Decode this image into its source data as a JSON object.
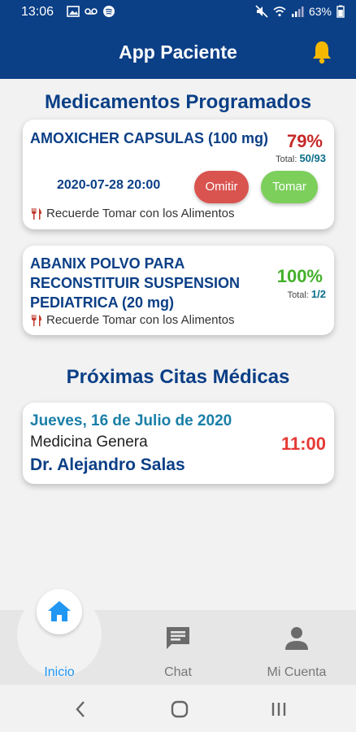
{
  "status_bar": {
    "time": "13:06",
    "battery": "63%",
    "left_icons": [
      "image-icon",
      "voicemail-icon",
      "spotify-icon"
    ],
    "right_icons": [
      "mute-icon",
      "wifi-icon",
      "signal-icon",
      "battery-icon"
    ]
  },
  "app_bar": {
    "title": "App Paciente",
    "bell_color": "#f5b800"
  },
  "sections": {
    "medications_title": "Medicamentos Programados",
    "appointments_title": "Próximas Citas Médicas"
  },
  "medications": [
    {
      "name": "AMOXICHER CAPSULAS (100 mg)",
      "percent": "79%",
      "percent_value": 0.79,
      "total_label": "Total:",
      "total_value": "50/93",
      "percent_color": "#c62828",
      "datetime": "2020-07-28 20:00",
      "omit_label": "Omitir",
      "take_label": "Tomar",
      "note": "Recuerde Tomar con los Alimentos"
    },
    {
      "name": "ABANIX POLVO PARA RECONSTITUIR SUSPENSION PEDIATRICA (20 mg)",
      "percent": "100%",
      "percent_value": 1.0,
      "total_label": "Total:",
      "total_value": "1/2",
      "percent_color": "#43b02a",
      "note": "Recuerde Tomar con los Alimentos"
    }
  ],
  "appointment": {
    "date": "Jueves, 16 de Julio de 2020",
    "specialty": "Medicina Genera",
    "doctor": "Dr. Alejandro Salas",
    "time": "11:00"
  },
  "bottom_nav": {
    "items": [
      {
        "label": "Inicio",
        "icon": "home-icon",
        "active": true
      },
      {
        "label": "Chat",
        "icon": "chat-icon",
        "active": false
      },
      {
        "label": "Mi Cuenta",
        "icon": "account-icon",
        "active": false
      }
    ]
  },
  "system_nav": [
    "back-icon",
    "home-circle-icon",
    "recents-icon"
  ],
  "colors": {
    "primary": "#0b3f86",
    "accent": "#2196f3",
    "danger": "#d9534f",
    "success": "#7ccf5b"
  }
}
